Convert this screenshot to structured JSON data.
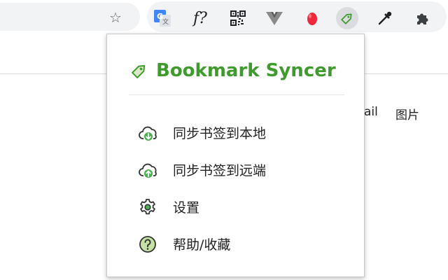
{
  "toolbar": {
    "star_icon": "star-icon",
    "extensions": [
      {
        "name": "google-translate-icon",
        "label": "G"
      },
      {
        "name": "function-icon",
        "label": "f?"
      },
      {
        "name": "qr-code-icon",
        "label": ""
      },
      {
        "name": "vue-devtools-icon",
        "label": ""
      },
      {
        "name": "red-drop-icon",
        "label": ""
      },
      {
        "name": "bookmark-tag-icon",
        "label": ""
      },
      {
        "name": "eyedropper-icon",
        "label": ""
      },
      {
        "name": "puzzle-extensions-icon",
        "label": ""
      }
    ]
  },
  "background_page": {
    "link_gmail_partial": "ail",
    "link_images": "图片"
  },
  "popup": {
    "title": "Bookmark Syncer",
    "brand_color": "#3f9b2d",
    "menu": [
      {
        "label": "同步书签到本地",
        "icon": "cloud-download-icon"
      },
      {
        "label": "同步书签到远端",
        "icon": "cloud-upload-icon"
      },
      {
        "label": "设置",
        "icon": "gear-icon"
      },
      {
        "label": "帮助/收藏",
        "icon": "help-icon"
      }
    ]
  }
}
